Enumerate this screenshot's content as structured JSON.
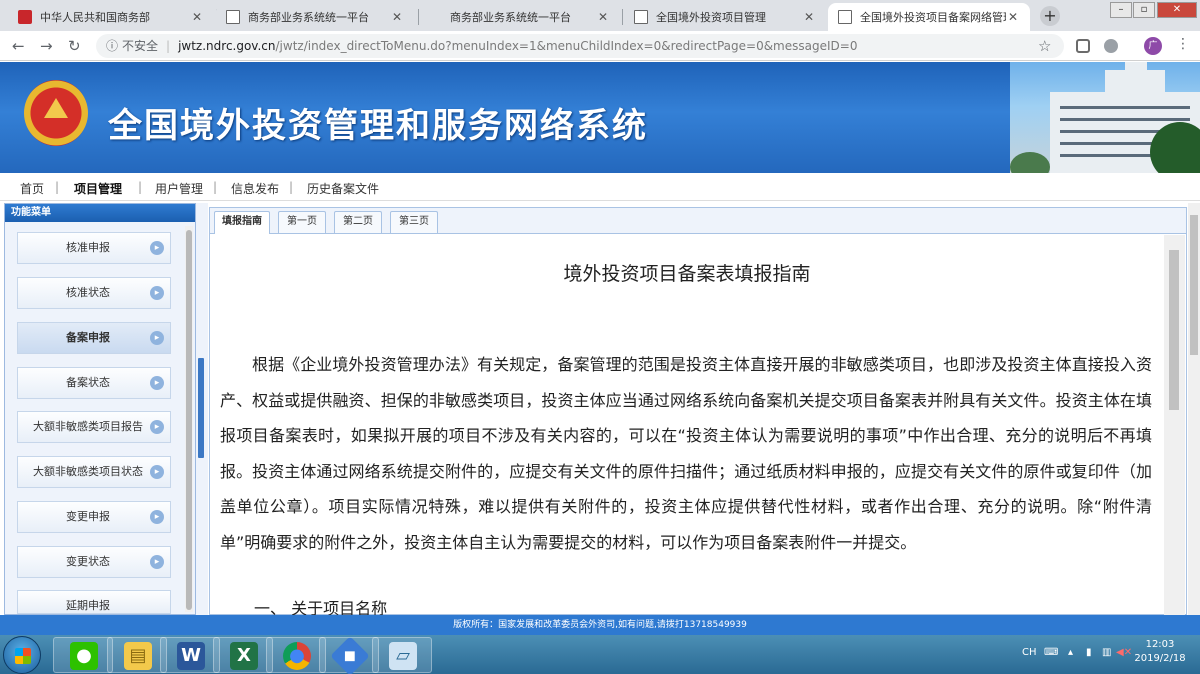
{
  "browser": {
    "tabs": [
      {
        "title": "中华人民共和国商务部",
        "favicon": "red-flag-icon"
      },
      {
        "title": "商务部业务系统统一平台",
        "favicon": "document-icon"
      },
      {
        "title": "商务部业务系统统一平台",
        "favicon": "document-icon"
      },
      {
        "title": "全国境外投资项目管理",
        "favicon": "document-icon"
      },
      {
        "title": "全国境外投资项目备案网络管理",
        "favicon": "document-icon"
      }
    ],
    "address": {
      "security": "不安全",
      "host": "jwtz.ndrc.gov.cn",
      "path": "/jwtz/index_directToMenu.do?menuIndex=1&menuChildIndex=0&redirectPage=0&messageID=0"
    },
    "avatar_text": "广"
  },
  "site": {
    "title": "全国境外投资管理和服务网络系统"
  },
  "nav": {
    "items": [
      "首页",
      "项目管理",
      "用户管理",
      "信息发布",
      "历史备案文件"
    ],
    "active": "项目管理"
  },
  "sidebar": {
    "header": "功能菜单",
    "items": [
      {
        "label": "核准申报"
      },
      {
        "label": "核准状态"
      },
      {
        "label": "备案申报",
        "selected": true
      },
      {
        "label": "备案状态"
      },
      {
        "label": "大额非敏感类项目报告"
      },
      {
        "label": "大额非敏感类项目状态"
      },
      {
        "label": "变更申报"
      },
      {
        "label": "变更状态"
      },
      {
        "label": "延期申报"
      }
    ]
  },
  "content": {
    "tabs": [
      "填报指南",
      "第一页",
      "第二页",
      "第三页"
    ],
    "active_tab": "填报指南",
    "doc_title": "境外投资项目备案表填报指南",
    "paragraph": "根据《企业境外投资管理办法》有关规定，备案管理的范围是投资主体直接开展的非敏感类项目，也即涉及投资主体直接投入资产、权益或提供融资、担保的非敏感类项目，投资主体应当通过网络系统向备案机关提交项目备案表并附具有关文件。投资主体在填报项目备案表时，如果拟开展的项目不涉及有关内容的，可以在“投资主体认为需要说明的事项”中作出合理、充分的说明后不再填报。投资主体通过网络系统提交附件的，应提交有关文件的原件扫描件；通过纸质材料申报的，应提交有关文件的原件或复印件（加盖单位公章）。项目实际情况特殊，难以提供有关附件的，投资主体应提供替代性材料，或者作出合理、充分的说明。除“附件清单”明确要求的附件之外，投资主体自主认为需要提交的材料，可以作为项目备案表附件一并提交。",
    "section_heading": "一、  关于项目名称"
  },
  "footer": {
    "text": "版权所有：国家发展和改革委员会外资司,如有问题,请拨打13718549939"
  },
  "taskbar": {
    "apps": [
      "wechat-icon",
      "file-explorer-icon",
      "word-icon",
      "excel-icon",
      "chrome-icon",
      "app-icon",
      "notepad-icon"
    ],
    "lang": "CH",
    "time": "12:03",
    "date": "2019/2/18"
  },
  "colors": {
    "banner_blue": "#2a72c8",
    "footer_blue": "#2e79d1",
    "taskbar": "#2f6f99"
  }
}
